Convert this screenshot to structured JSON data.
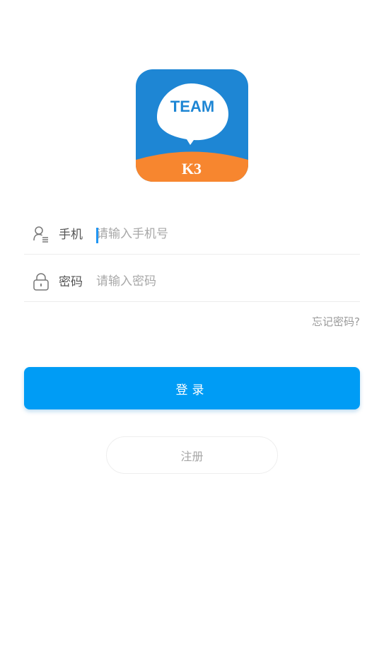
{
  "logo": {
    "text": "TEAM",
    "badge_text": "K3",
    "colors": {
      "top": "#1e86d4",
      "bottom": "#f7862f",
      "bubble": "#ffffff",
      "text": "#1e86d4"
    }
  },
  "form": {
    "phone": {
      "icon": "user-list-icon",
      "label": "手机",
      "placeholder": "请输入手机号"
    },
    "password": {
      "icon": "lock-icon",
      "label": "密码",
      "placeholder": "请输入密码"
    }
  },
  "forgot_password": "忘记密码?",
  "login_button": "登录",
  "register_button": "注册",
  "colors": {
    "primary": "#009cf5",
    "placeholder": "#a8a8a8",
    "divider": "#ececec"
  }
}
